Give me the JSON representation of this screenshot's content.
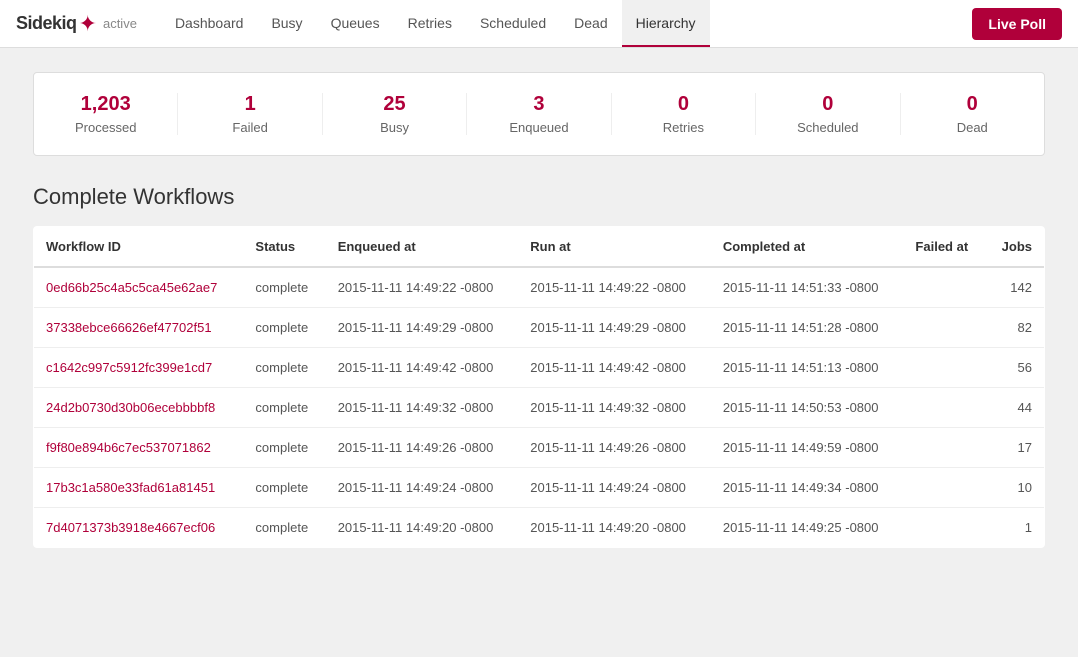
{
  "brand": {
    "name": "Sidekiq",
    "icon": "✦",
    "status": "active"
  },
  "nav": {
    "links": [
      {
        "label": "Dashboard",
        "active": false
      },
      {
        "label": "Busy",
        "active": false
      },
      {
        "label": "Queues",
        "active": false
      },
      {
        "label": "Retries",
        "active": false
      },
      {
        "label": "Scheduled",
        "active": false
      },
      {
        "label": "Dead",
        "active": false
      },
      {
        "label": "Hierarchy",
        "active": true
      }
    ],
    "live_poll_label": "Live Poll"
  },
  "stats": [
    {
      "number": "1,203",
      "label": "Processed"
    },
    {
      "number": "1",
      "label": "Failed"
    },
    {
      "number": "25",
      "label": "Busy"
    },
    {
      "number": "3",
      "label": "Enqueued"
    },
    {
      "number": "0",
      "label": "Retries"
    },
    {
      "number": "0",
      "label": "Scheduled"
    },
    {
      "number": "0",
      "label": "Dead"
    }
  ],
  "section_title": "Complete Workflows",
  "table": {
    "columns": [
      "Workflow ID",
      "Status",
      "Enqueued at",
      "Run at",
      "Completed at",
      "Failed at",
      "Jobs"
    ],
    "rows": [
      {
        "id": "0ed66b25c4a5c5ca45e62ae7",
        "status": "complete",
        "enqueued_at": "2015-11-11 14:49:22 -0800",
        "run_at": "2015-11-11 14:49:22 -0800",
        "completed_at": "2015-11-11 14:51:33 -0800",
        "failed_at": "",
        "jobs": "142"
      },
      {
        "id": "37338ebce66626ef47702f51",
        "status": "complete",
        "enqueued_at": "2015-11-11 14:49:29 -0800",
        "run_at": "2015-11-11 14:49:29 -0800",
        "completed_at": "2015-11-11 14:51:28 -0800",
        "failed_at": "",
        "jobs": "82"
      },
      {
        "id": "c1642c997c5912fc399e1cd7",
        "status": "complete",
        "enqueued_at": "2015-11-11 14:49:42 -0800",
        "run_at": "2015-11-11 14:49:42 -0800",
        "completed_at": "2015-11-11 14:51:13 -0800",
        "failed_at": "",
        "jobs": "56"
      },
      {
        "id": "24d2b0730d30b06ecebbbbf8",
        "status": "complete",
        "enqueued_at": "2015-11-11 14:49:32 -0800",
        "run_at": "2015-11-11 14:49:32 -0800",
        "completed_at": "2015-11-11 14:50:53 -0800",
        "failed_at": "",
        "jobs": "44"
      },
      {
        "id": "f9f80e894b6c7ec537071862",
        "status": "complete",
        "enqueued_at": "2015-11-11 14:49:26 -0800",
        "run_at": "2015-11-11 14:49:26 -0800",
        "completed_at": "2015-11-11 14:49:59 -0800",
        "failed_at": "",
        "jobs": "17"
      },
      {
        "id": "17b3c1a580e33fad61a81451",
        "status": "complete",
        "enqueued_at": "2015-11-11 14:49:24 -0800",
        "run_at": "2015-11-11 14:49:24 -0800",
        "completed_at": "2015-11-11 14:49:34 -0800",
        "failed_at": "",
        "jobs": "10"
      },
      {
        "id": "7d4071373b3918e4667ecf06",
        "status": "complete",
        "enqueued_at": "2015-11-11 14:49:20 -0800",
        "run_at": "2015-11-11 14:49:20 -0800",
        "completed_at": "2015-11-11 14:49:25 -0800",
        "failed_at": "",
        "jobs": "1"
      }
    ]
  }
}
